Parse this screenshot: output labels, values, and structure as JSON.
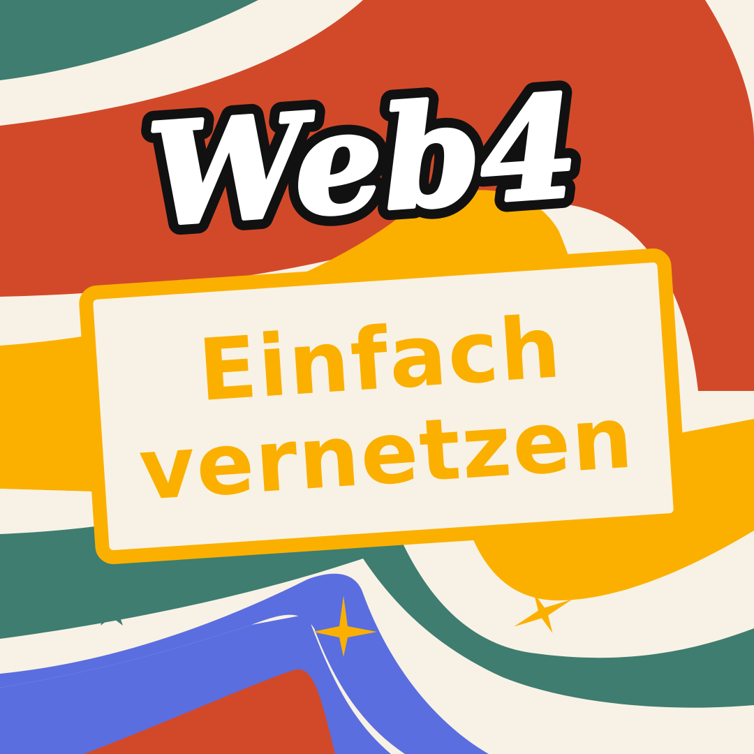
{
  "logo": {
    "text": "Web4"
  },
  "headline": {
    "line1": "Einfach",
    "line2": "vernetzen"
  },
  "colors": {
    "cream": "#f8f2e6",
    "red": "#d2492a",
    "teal": "#3e7d70",
    "yellow": "#fbb000",
    "blue": "#5a6ee0",
    "logo_fill": "#ffffff",
    "logo_outline": "#111111"
  },
  "icons": [
    "sparkle-icon",
    "sparkle-icon",
    "sparkle-icon"
  ]
}
